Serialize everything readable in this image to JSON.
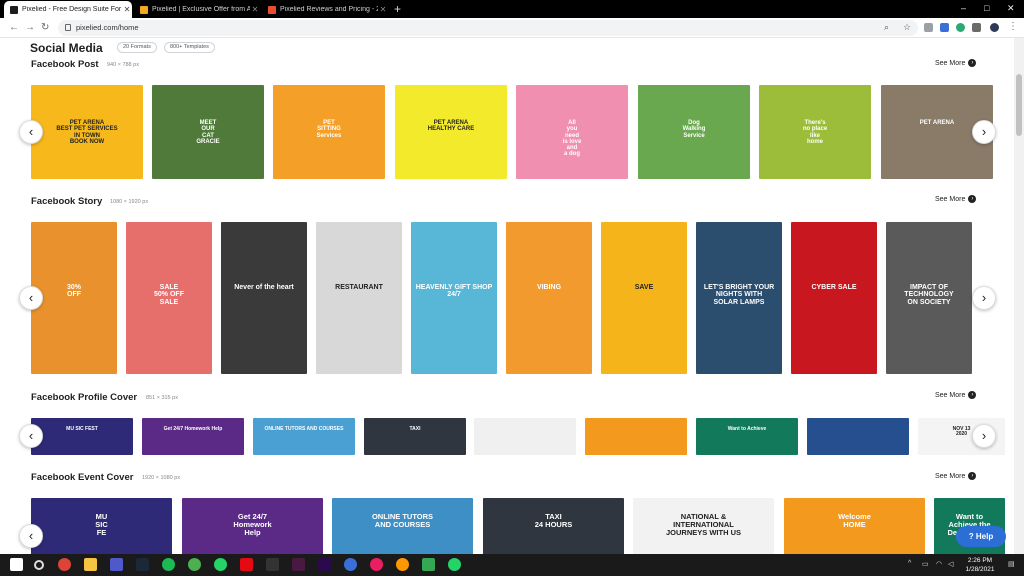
{
  "browser": {
    "tabs": [
      {
        "title": "Pixelied - Free Design Suite For M",
        "active": true,
        "color": "#1d1d1d"
      },
      {
        "title": "Pixelied | Exclusive Offer from Ap",
        "active": false,
        "color": "#f5a623"
      },
      {
        "title": "Pixelied Reviews and Pricing - 20",
        "active": false,
        "color": "#e94e2a"
      }
    ],
    "new_tab": "+",
    "url": "pixelied.com/home",
    "window_controls": [
      "–",
      "□",
      "✕"
    ]
  },
  "page": {
    "title": "Social Media",
    "chips": [
      "20 Formats",
      "800+ Templates"
    ],
    "see_more": "See More",
    "help": "Help"
  },
  "sections": [
    {
      "title": "Facebook Post",
      "size": "940 × 788 px",
      "cards": [
        {
          "bg": "#f7b81b",
          "text": "PET ARENA\nBEST PET SERVICES\nIN TOWN\nBOOK NOW"
        },
        {
          "bg": "#4f7a3a",
          "text": "MEET\nOUR\nCAT\nGRACIE"
        },
        {
          "bg": "#f4a028",
          "text": "PET\nSITTING\nServices"
        },
        {
          "bg": "#f3ea2b",
          "text": "PET ARENA\nHEALTHY CARE"
        },
        {
          "bg": "#f08fb0",
          "text": "All\nyou\nneed\nis love\nand\na dog"
        },
        {
          "bg": "#6aa84f",
          "text": "Dog\nWalking\nService"
        },
        {
          "bg": "#9bbd3a",
          "text": "There's\nno place\nlike\nhome"
        },
        {
          "bg": "#8a7a68",
          "text": "PET ARENA"
        }
      ]
    },
    {
      "title": "Facebook Story",
      "size": "1080 × 1920 px",
      "cards": [
        {
          "bg": "#e9922d",
          "text": "30%\nOFF"
        },
        {
          "bg": "#e66f6c",
          "text": "SALE\n50% OFF\nSALE"
        },
        {
          "bg": "#3a3a3a",
          "text": "Never of the heart"
        },
        {
          "bg": "#d8d8d8",
          "text": "RESTAURANT"
        },
        {
          "bg": "#58b7d6",
          "text": "HEAVENLY GIFT SHOP 24/7"
        },
        {
          "bg": "#f39a2e",
          "text": "VIBING"
        },
        {
          "bg": "#f4b41a",
          "text": "SAVE"
        },
        {
          "bg": "#2b4d6e",
          "text": "LET'S BRIGHT YOUR NIGHTS WITH\nSOLAR LAMPS"
        },
        {
          "bg": "#c8171e",
          "text": "CYBER SALE"
        },
        {
          "bg": "#5a5a5a",
          "text": "IMPACT OF\nTECHNOLOGY\nON SOCIETY"
        }
      ]
    },
    {
      "title": "Facebook Profile Cover",
      "size": "851 × 315 px",
      "cards": [
        {
          "bg": "#2e2a78",
          "text": "MU SIC FEST"
        },
        {
          "bg": "#5b2a86",
          "text": "Get 24/7 Homework Help"
        },
        {
          "bg": "#4a9fd3",
          "text": "ONLINE TUTORS AND COURSES"
        },
        {
          "bg": "#2f3640",
          "text": "TAXI"
        },
        {
          "bg": "#f0f0f0",
          "text": ""
        },
        {
          "bg": "#f39a1e",
          "text": ""
        },
        {
          "bg": "#127a5b",
          "text": "Want to Achieve"
        },
        {
          "bg": "#264f8f",
          "text": ""
        },
        {
          "bg": "#f4f4f4",
          "text": "NOV 13\n2020"
        }
      ]
    },
    {
      "title": "Facebook Event Cover",
      "size": "1920 × 1080 px",
      "cards": [
        {
          "bg": "#2e2a78",
          "text": "MU\nSIC\nFE"
        },
        {
          "bg": "#5b2a86",
          "text": "Get 24/7\nHomework\nHelp"
        },
        {
          "bg": "#3f8fc7",
          "text": "ONLINE TUTORS\nAND COURSES"
        },
        {
          "bg": "#2f3640",
          "text": "TAXI\n24 HOURS"
        },
        {
          "bg": "#f2f2f2",
          "text": "NATIONAL &\nINTERNATIONAL\nJOURNEYS WITH US"
        },
        {
          "bg": "#f39a1e",
          "text": "Welcome\nHOME"
        },
        {
          "bg": "#127a5b",
          "text": "Want to\nAchieve the\nDesired SAT\nScore"
        }
      ]
    }
  ],
  "taskbar": {
    "time": "2:26 PM",
    "date": "1/28/2021"
  }
}
